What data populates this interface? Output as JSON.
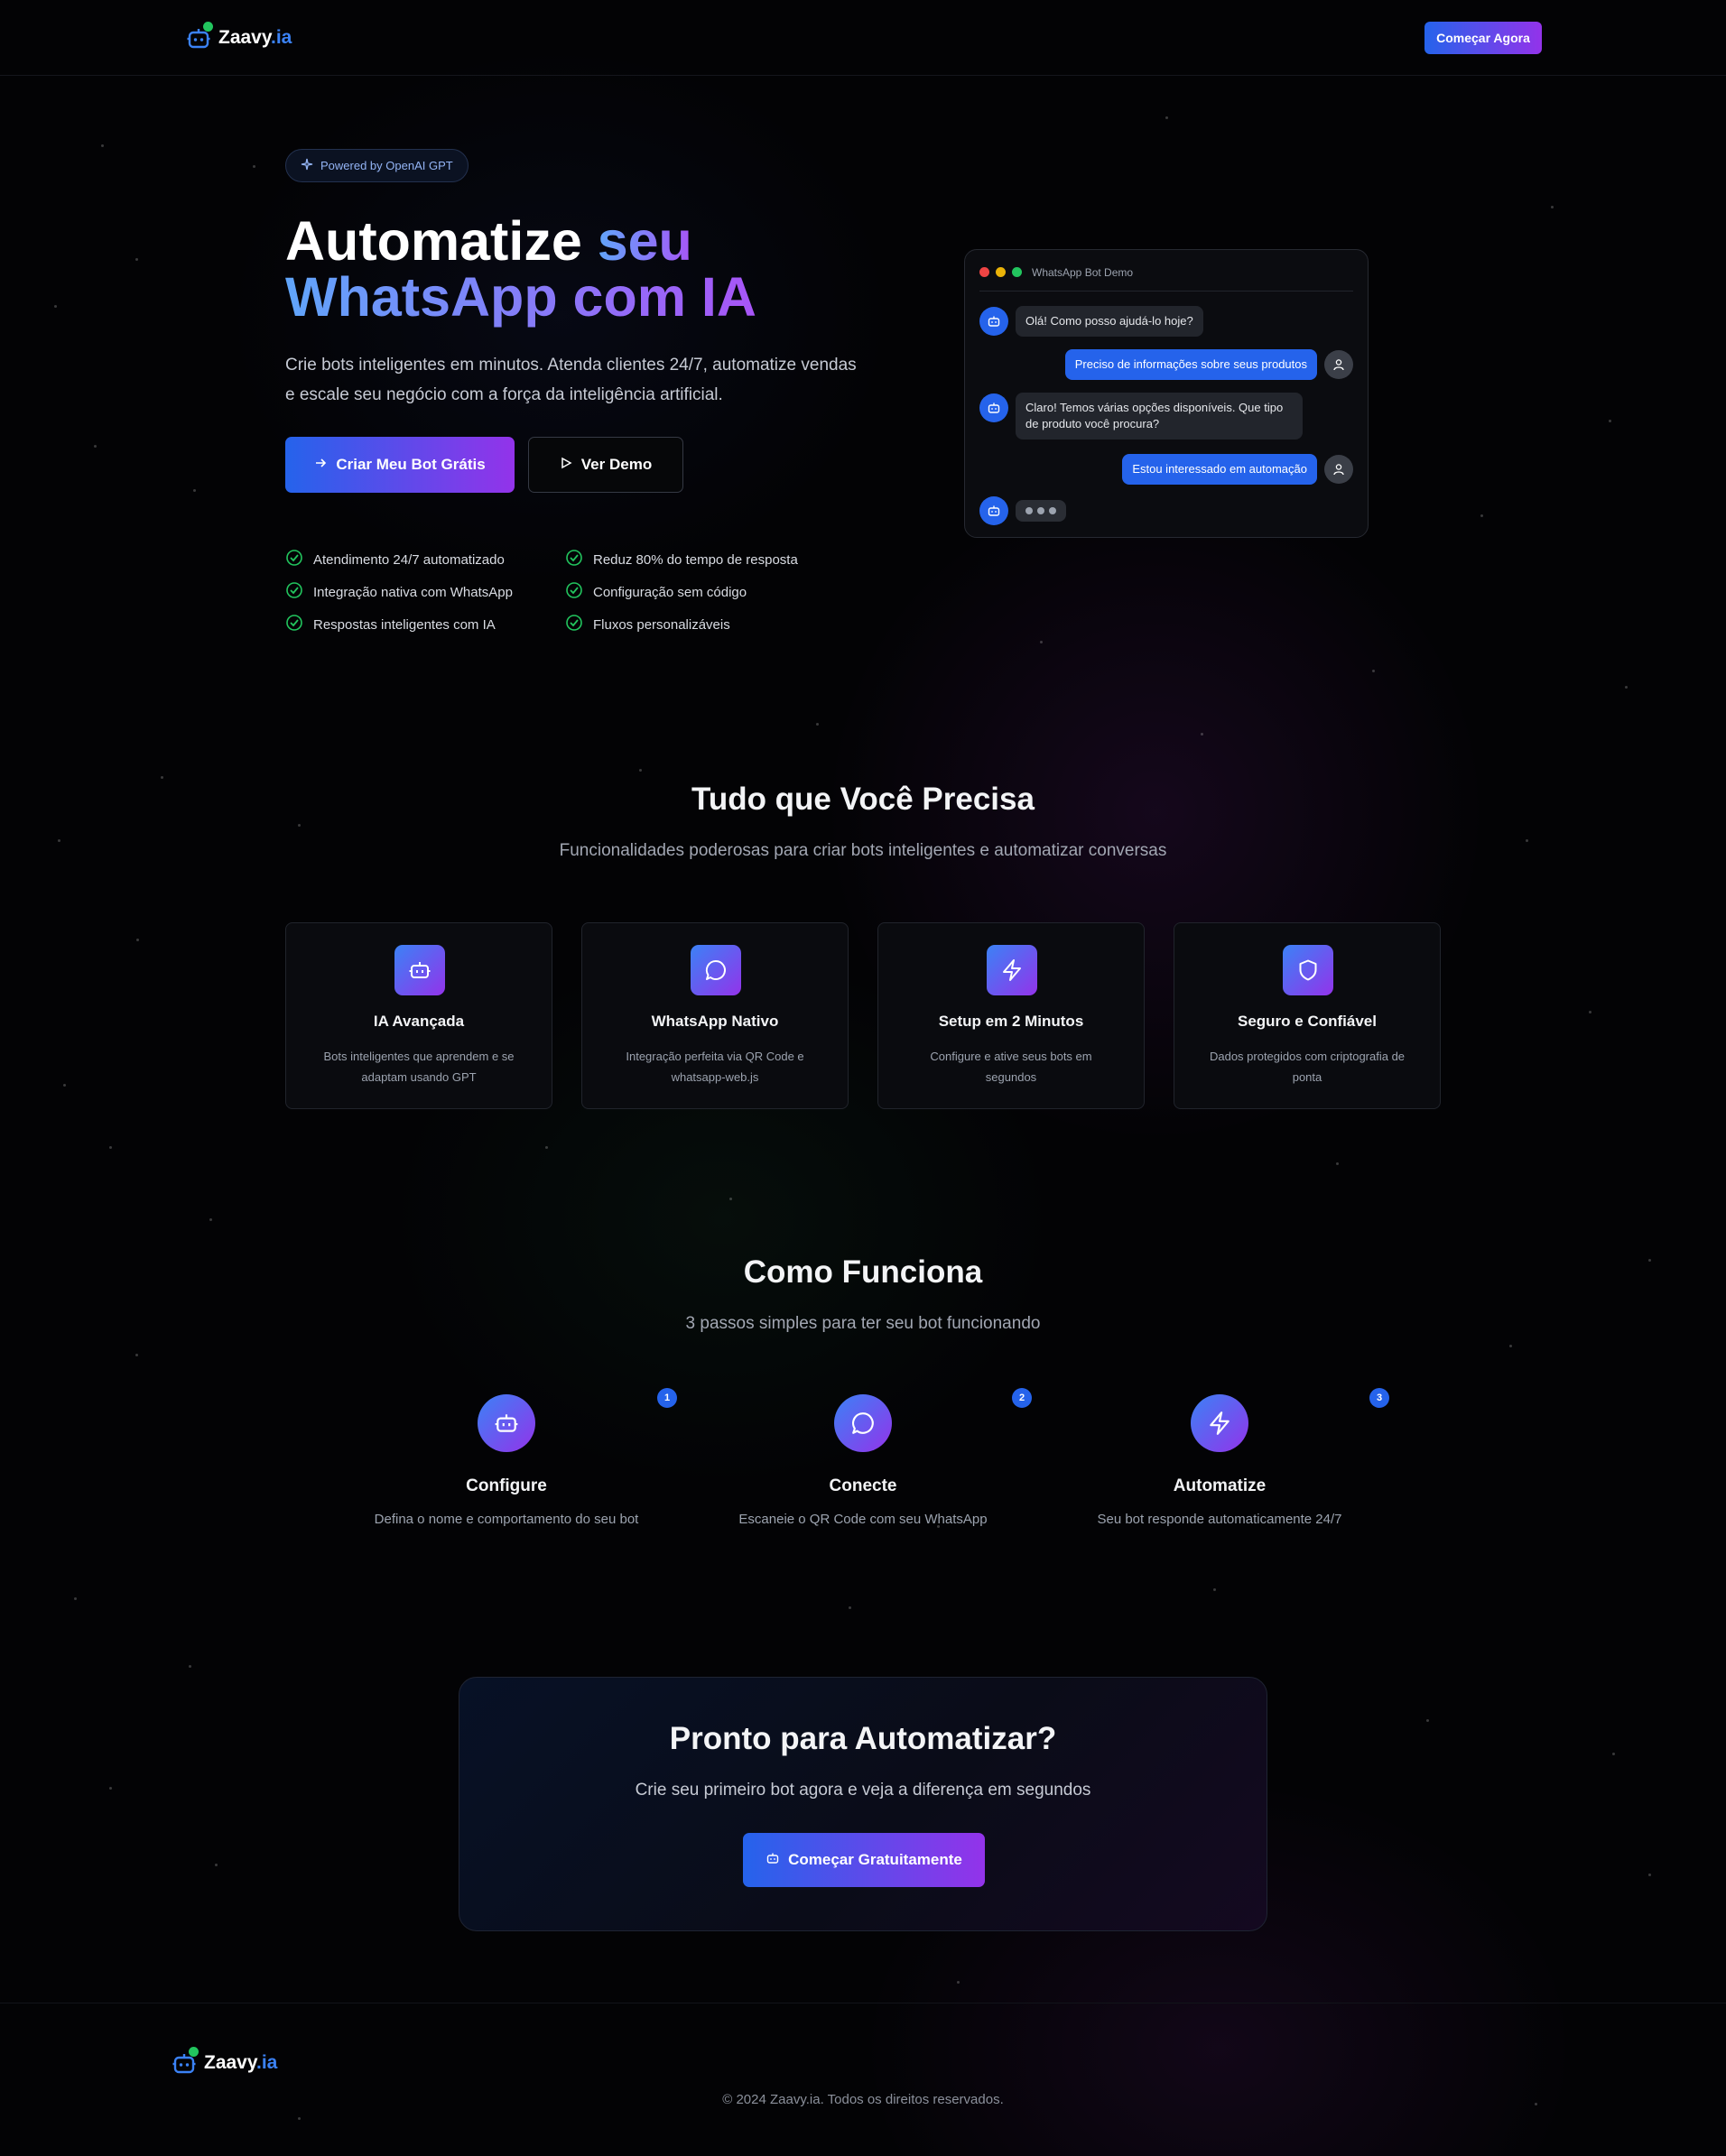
{
  "brand": {
    "name": "Zaavy",
    "suffix": ".ia"
  },
  "nav": {
    "cta_label": "Começar Agora"
  },
  "hero": {
    "badge_icon": "sparkles-icon",
    "badge": "Powered by OpenAI GPT",
    "title_line1": "Automatize",
    "title_highlight1": "seu",
    "title_line2": "WhatsApp com IA",
    "subtitle": "Crie bots inteligentes em minutos. Atenda clientes 24/7, automatize vendas e escale seu negócio com a força da inteligência artificial.",
    "primary_cta": "Criar Meu Bot Grátis",
    "secondary_cta": "Ver Demo",
    "features": [
      "Atendimento 24/7 automatizado",
      "Reduz 80% do tempo de resposta",
      "Integração nativa com WhatsApp",
      "Configuração sem código",
      "Respostas inteligentes com IA",
      "Fluxos personalizáveis"
    ]
  },
  "chat_demo": {
    "title": "WhatsApp Bot Demo",
    "messages": [
      {
        "from": "bot",
        "text": "Olá! Como posso ajudá-lo hoje?"
      },
      {
        "from": "user",
        "text": "Preciso de informações sobre seus produtos"
      },
      {
        "from": "bot",
        "text": "Claro! Temos várias opções disponíveis. Que tipo de produto você procura?"
      },
      {
        "from": "user",
        "text": "Estou interessado em automação"
      }
    ]
  },
  "features_section": {
    "title": "Tudo que Você Precisa",
    "subtitle": "Funcionalidades poderosas para criar bots inteligentes e automatizar conversas",
    "cards": [
      {
        "icon": "bot-icon",
        "title": "IA Avançada",
        "desc": "Bots inteligentes que aprendem e se adaptam usando GPT"
      },
      {
        "icon": "message-circle-icon",
        "title": "WhatsApp Nativo",
        "desc": "Integração perfeita via QR Code e whatsapp-web.js"
      },
      {
        "icon": "lightning-icon",
        "title": "Setup em 2 Minutos",
        "desc": "Configure e ative seus bots em segundos"
      },
      {
        "icon": "shield-icon",
        "title": "Seguro e Confiável",
        "desc": "Dados protegidos com criptografia de ponta"
      }
    ]
  },
  "how_section": {
    "title": "Como Funciona",
    "subtitle": "3 passos simples para ter seu bot funcionando",
    "steps": [
      {
        "num": "1",
        "icon": "bot-icon",
        "title": "Configure",
        "desc": "Defina o nome e comportamento do seu bot"
      },
      {
        "num": "2",
        "icon": "message-circle-icon",
        "title": "Conecte",
        "desc": "Escaneie o QR Code com seu WhatsApp"
      },
      {
        "num": "3",
        "icon": "lightning-icon",
        "title": "Automatize",
        "desc": "Seu bot responde automaticamente 24/7"
      }
    ]
  },
  "cta_section": {
    "title": "Pronto para Automatizar?",
    "subtitle": "Crie seu primeiro bot agora e veja a diferença em segundos",
    "button": "Começar Gratuitamente"
  },
  "footer": {
    "copyright": "© 2024 Zaavy.ia. Todos os direitos reservados."
  },
  "colors": {
    "accent_blue": "#2563eb",
    "accent_purple": "#9333ea",
    "check_green": "#22c55e",
    "background": "#030305"
  }
}
